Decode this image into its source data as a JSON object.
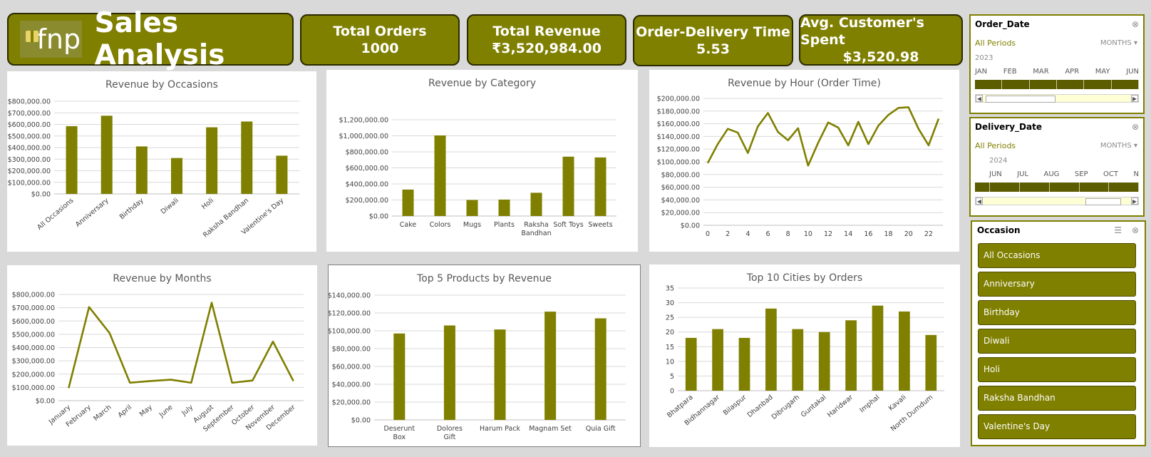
{
  "header": {
    "logo_text": "fnp",
    "title": "Sales Analysis",
    "kpis": [
      {
        "label": "Total Orders",
        "value": "1000"
      },
      {
        "label": "Total Revenue",
        "value": "₹3,520,984.00"
      },
      {
        "label": "Order-Delivery Time",
        "value": "5.53"
      },
      {
        "label": "Avg. Customer's Spent",
        "value": "$3,520.98"
      }
    ]
  },
  "slicers": {
    "order_date": {
      "title": "Order_Date",
      "periods": "All Periods",
      "level": "MONTHS",
      "year": "2023",
      "months": [
        "JAN",
        "FEB",
        "MAR",
        "APR",
        "MAY",
        "JUN"
      ]
    },
    "delivery_date": {
      "title": "Delivery_Date",
      "periods": "All Periods",
      "level": "MONTHS",
      "year": "2024",
      "months": [
        "JUN",
        "JUL",
        "AUG",
        "SEP",
        "OCT",
        "N"
      ]
    },
    "occasion": {
      "title": "Occasion",
      "items": [
        "All Occasions",
        "Anniversary",
        "Birthday",
        "Diwali",
        "Holi",
        "Raksha Bandhan",
        "Valentine's Day"
      ]
    }
  },
  "icons": {
    "filter_clear": "filter-clear-icon",
    "multi_select": "multi-select-icon",
    "level_dropdown": "chevron-down-icon"
  },
  "colors": {
    "accent": "#7f7f00",
    "accent_dark": "#5c5c00",
    "background": "#d9d9d9"
  },
  "chart_data": [
    {
      "id": "occasions",
      "type": "bar",
      "title": "Revenue by Occasions",
      "categories": [
        "All Occasions",
        "Anniversary",
        "Birthday",
        "Diwali",
        "Holi",
        "Raksha Bandhan",
        "Valentine's Day"
      ],
      "values": [
        585000,
        675000,
        410000,
        310000,
        575000,
        625000,
        330000
      ],
      "yticks": [
        "$0.00",
        "$100,000.00",
        "$200,000.00",
        "$300,000.00",
        "$400,000.00",
        "$500,000.00",
        "$600,000.00",
        "$700,000.00",
        "$800,000.00"
      ],
      "ylim": [
        0,
        800000
      ],
      "grid": true,
      "rotate_x": true
    },
    {
      "id": "category",
      "type": "bar",
      "title": "Revenue by Category",
      "categories": [
        "Cake",
        "Colors",
        "Mugs",
        "Plants",
        "Raksha Bandhan",
        "Soft Toys",
        "Sweets"
      ],
      "values": [
        330000,
        1005000,
        200000,
        205000,
        290000,
        740000,
        730000
      ],
      "yticks": [
        "$0.00",
        "$200,000.00",
        "$400,000.00",
        "$600,000.00",
        "$800,000.00",
        "$1,000,000.00",
        "$1,200,000.00"
      ],
      "ylim": [
        0,
        1200000
      ],
      "grid": true,
      "rotate_x": false
    },
    {
      "id": "hour",
      "type": "line",
      "title": "Revenue by Hour (Order Time)",
      "x": [
        0,
        1,
        2,
        3,
        4,
        5,
        6,
        7,
        8,
        9,
        10,
        11,
        12,
        13,
        14,
        15,
        16,
        17,
        18,
        19,
        20,
        21,
        22,
        23
      ],
      "values": [
        98000,
        128000,
        152000,
        146000,
        114000,
        156000,
        177000,
        147000,
        134000,
        153000,
        94000,
        130000,
        162000,
        154000,
        126000,
        163000,
        128000,
        157000,
        174000,
        185000,
        186000,
        152000,
        126000,
        168000
      ],
      "xticks": [
        "0",
        "2",
        "4",
        "6",
        "8",
        "10",
        "12",
        "14",
        "16",
        "18",
        "20",
        "22"
      ],
      "yticks": [
        "$0.00",
        "$20,000.00",
        "$40,000.00",
        "$60,000.00",
        "$80,000.00",
        "$100,000.00",
        "$120,000.00",
        "$140,000.00",
        "$160,000.00",
        "$180,000.00",
        "$200,000.00"
      ],
      "ylim": [
        0,
        200000
      ],
      "xlim": [
        0,
        23
      ],
      "grid": true
    },
    {
      "id": "months",
      "type": "line",
      "title": "Revenue by Months",
      "categories": [
        "January",
        "February",
        "March",
        "April",
        "May",
        "June",
        "July",
        "August",
        "September",
        "October",
        "November",
        "December"
      ],
      "values": [
        95000,
        705000,
        510000,
        135000,
        148000,
        158000,
        135000,
        738000,
        135000,
        152000,
        445000,
        148000
      ],
      "yticks": [
        "$0.00",
        "$100,000.00",
        "$200,000.00",
        "$300,000.00",
        "$400,000.00",
        "$500,000.00",
        "$600,000.00",
        "$700,000.00",
        "$800,000.00"
      ],
      "ylim": [
        0,
        800000
      ],
      "grid": true,
      "rotate_x": true
    },
    {
      "id": "products",
      "type": "bar",
      "title": "Top 5 Products by Revenue",
      "categories": [
        "Deserunt Box",
        "Dolores Gift",
        "Harum Pack",
        "Magnam Set",
        "Quia Gift"
      ],
      "values": [
        97000,
        106000,
        101500,
        121500,
        114000
      ],
      "yticks": [
        "$0.00",
        "$20,000.00",
        "$40,000.00",
        "$60,000.00",
        "$80,000.00",
        "$100,000.00",
        "$120,000.00",
        "$140,000.00"
      ],
      "ylim": [
        0,
        140000
      ],
      "grid": true,
      "rotate_x": false
    },
    {
      "id": "cities",
      "type": "bar",
      "title": "Top 10 Cities by Orders",
      "categories": [
        "Bhatpara",
        "Bidhannagar",
        "Bilaspur",
        "Dhanbad",
        "Dibrugarh",
        "Guntakal",
        "Haridwar",
        "Imphal",
        "Kavali",
        "North Dumdum"
      ],
      "values": [
        18,
        21,
        18,
        28,
        21,
        20,
        24,
        29,
        27,
        19
      ],
      "yticks": [
        "0",
        "5",
        "10",
        "15",
        "20",
        "25",
        "30",
        "35"
      ],
      "ylim": [
        0,
        35
      ],
      "grid": true,
      "rotate_x": true
    }
  ]
}
